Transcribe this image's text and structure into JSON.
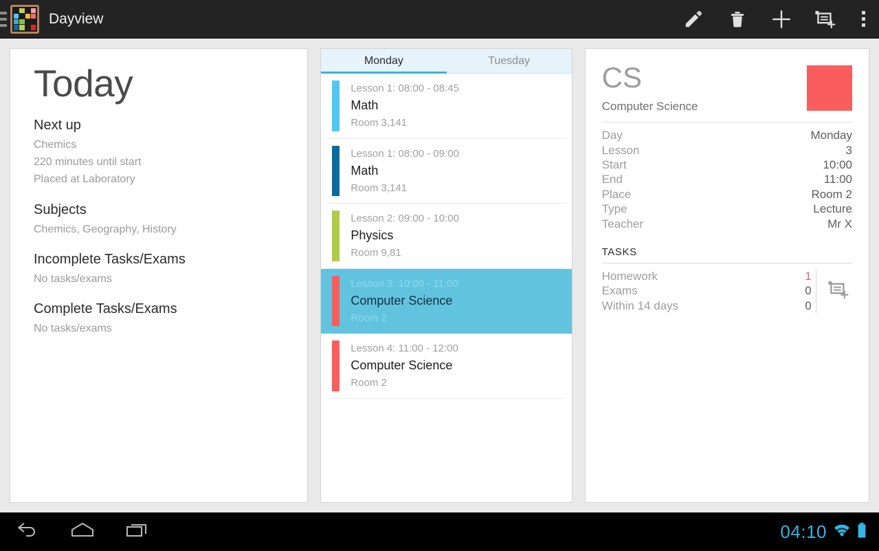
{
  "appbar": {
    "title": "Dayview",
    "drawer_icon": "hamburger-icon",
    "app_icon": "palette-grid-icon",
    "icon_colors": [
      "#1c1c1c",
      "#b9cf5f",
      "#1c1c1c",
      "#f4a0a0",
      "#4fc9f4",
      "#1c1c1c",
      "#f2b33d",
      "#f26d6d",
      "#4aa3d0",
      "#8fbf3f",
      "#1c1c1c",
      "#1c1c1c",
      "#0a6c9e",
      "#b9cf5f",
      "#1c1c1c",
      "#d9262e"
    ],
    "actions": [
      {
        "name": "edit-button",
        "icon": "pencil-icon",
        "label": "Edit"
      },
      {
        "name": "delete-button",
        "icon": "trash-icon",
        "label": "Delete"
      },
      {
        "name": "add-button",
        "icon": "plus-icon",
        "label": "Add"
      },
      {
        "name": "add-task-button",
        "icon": "add-task-icon",
        "label": "Add task"
      },
      {
        "name": "overflow-button",
        "icon": "more-vertical-icon",
        "label": "More options"
      }
    ]
  },
  "today": {
    "heading": "Today",
    "sections": [
      {
        "title": "Next up",
        "lines": [
          "Chemics",
          "220 minutes until start",
          "Placed at Laboratory"
        ]
      },
      {
        "title": "Subjects",
        "lines": [
          "Chemics, Geography, History"
        ]
      },
      {
        "title": "Incomplete Tasks/Exams",
        "lines": [
          "No tasks/exams"
        ]
      },
      {
        "title": "Complete Tasks/Exams",
        "lines": [
          "No tasks/exams"
        ]
      }
    ]
  },
  "lessons": {
    "tabs": [
      {
        "label": "Monday",
        "active": true
      },
      {
        "label": "Tuesday",
        "active": false
      }
    ],
    "rows": [
      {
        "meta": "Lesson 1: 08:00 - 08:45",
        "title": "Math",
        "room": "Room 3,141",
        "color": "#4fc9f4",
        "selected": false
      },
      {
        "meta": "Lesson 1: 08:00 - 09:00",
        "title": "Math",
        "room": "Room 3,141",
        "color": "#0a6c9e",
        "selected": false
      },
      {
        "meta": "Lesson 2: 09:00 - 10:00",
        "title": "Physics",
        "room": "Room 9,81",
        "color": "#afcb48",
        "selected": false
      },
      {
        "meta": "Lesson 3: 10:00 - 11:00",
        "title": "Computer Science",
        "room": "Room 2",
        "color": "#fa5d5d",
        "selected": true
      },
      {
        "meta": "Lesson 4: 11:00 - 12:00",
        "title": "Computer Science",
        "room": "Room 2",
        "color": "#fa5d5d",
        "selected": false
      }
    ],
    "selection_color": "#62c3df"
  },
  "detail": {
    "abbrev": "CS",
    "subject": "Computer Science",
    "swatch_color": "#fa5d5d",
    "rows": [
      {
        "label": "Day",
        "value": "Monday"
      },
      {
        "label": "Lesson",
        "value": "3"
      },
      {
        "label": "Start",
        "value": "10:00"
      },
      {
        "label": "End",
        "value": "11:00"
      },
      {
        "label": "Place",
        "value": "Room 2"
      },
      {
        "label": "Type",
        "value": "Lecture"
      },
      {
        "label": "Teacher",
        "value": "Mr X"
      }
    ],
    "tasks_heading": "TASKS",
    "tasks": [
      {
        "label": "Homework",
        "count": "1",
        "warn": true
      },
      {
        "label": "Exams",
        "count": "0",
        "warn": false
      },
      {
        "label": "Within 14 days",
        "count": "0",
        "warn": false
      }
    ],
    "add_task_icon": "add-task-icon"
  },
  "navbar": {
    "buttons": [
      {
        "name": "back-button",
        "icon": "back-arrow-icon"
      },
      {
        "name": "home-button",
        "icon": "home-icon"
      },
      {
        "name": "recents-button",
        "icon": "recents-icon"
      }
    ],
    "clock": "04:10",
    "wifi_icon": "wifi-icon",
    "battery_icon": "battery-full-icon",
    "accent_color": "#33b5e5"
  }
}
